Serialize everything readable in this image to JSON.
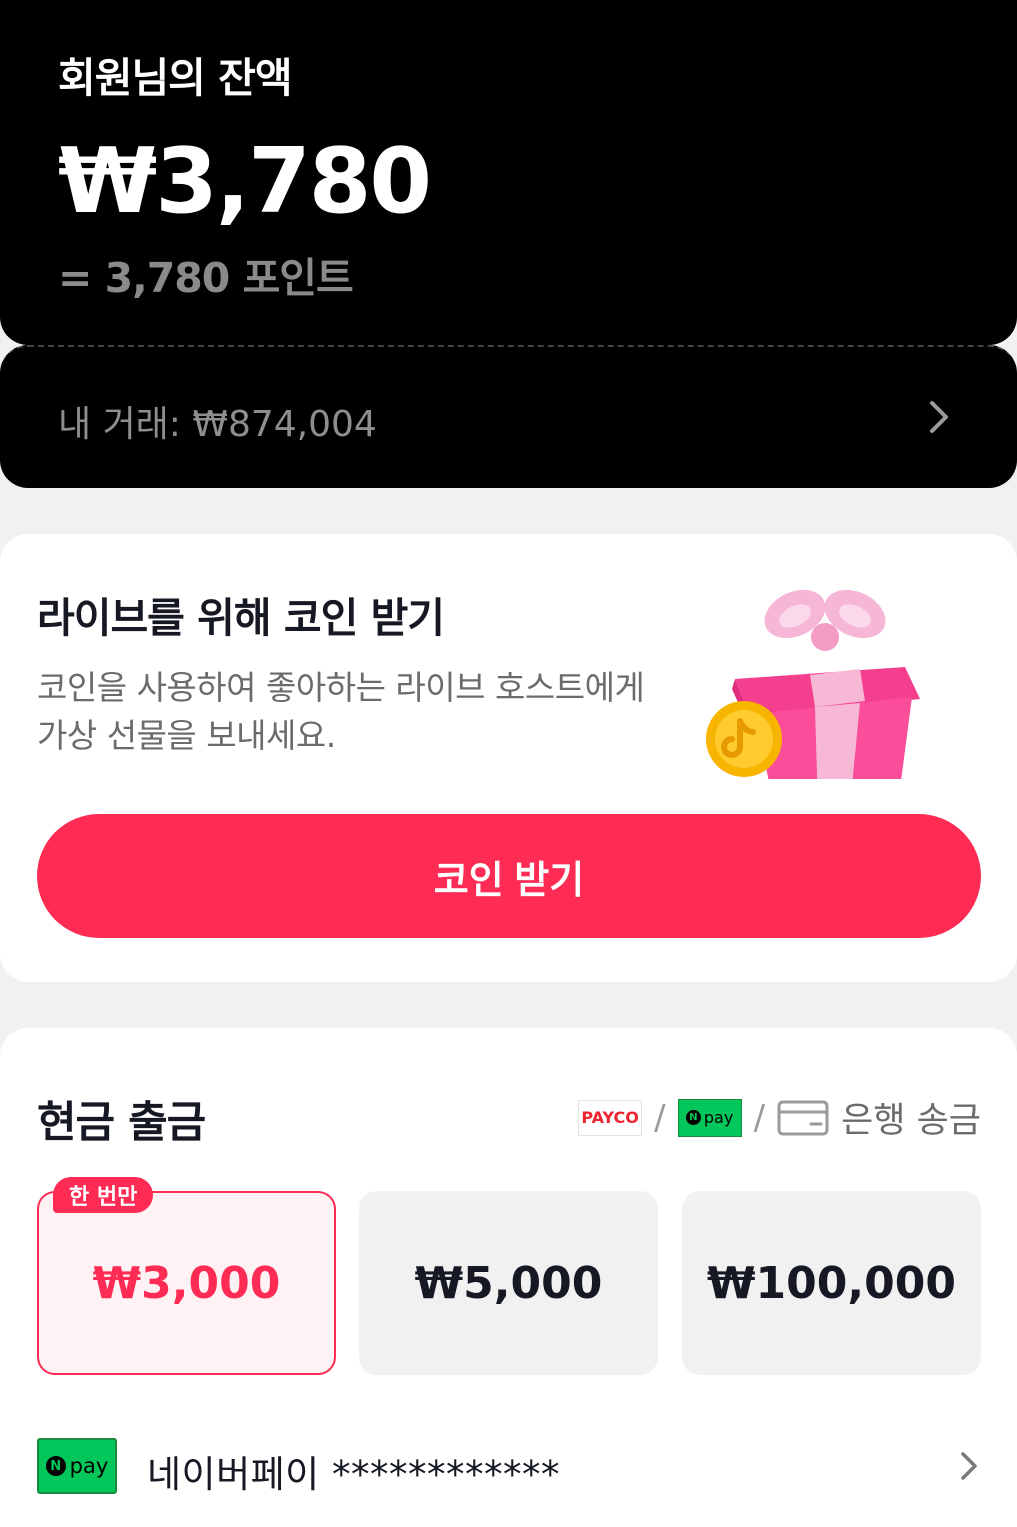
{
  "balance": {
    "title": "회원님의 잔액",
    "amount": "₩3,780",
    "points": "= 3,780 포인트"
  },
  "transactions": {
    "label": "내 거래: ₩874,004"
  },
  "coins": {
    "heading": "라이브를 위해 코인 받기",
    "description": "코인을 사용하여 좋아하는 라이브 호스트에게 가상 선물을 보내세요.",
    "button_label": "코인 받기"
  },
  "cash_out": {
    "heading": "현금 출금",
    "methods": {
      "payco": "PAYCO",
      "npay": "pay",
      "separator": "/",
      "bank": "은행 송금"
    },
    "options": [
      {
        "amount": "₩3,000",
        "badge": "한 번만",
        "selected": true
      },
      {
        "amount": "₩5,000",
        "selected": false
      },
      {
        "amount": "₩100,000",
        "selected": false
      }
    ],
    "account": {
      "logo_text": "pay",
      "label": "네이버페이 ************"
    }
  },
  "colors": {
    "accent": "#fe2c55",
    "npay_green": "#03c75a",
    "card_dark": "#000000"
  }
}
